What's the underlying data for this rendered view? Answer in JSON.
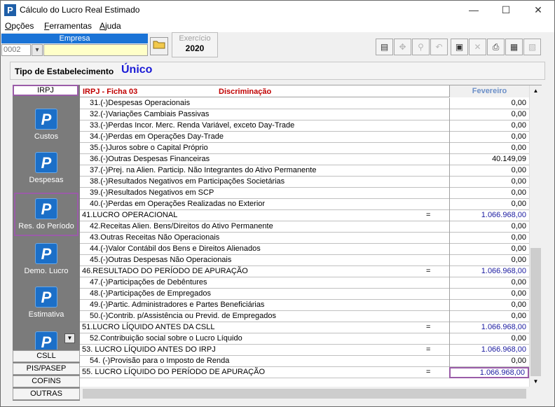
{
  "window": {
    "title": "Cálculo do Lucro Real Estimado",
    "icon_letter": "P",
    "minimize": "—",
    "maximize": "☐",
    "close": "✕"
  },
  "menu": [
    {
      "u": "O",
      "rest": "pções"
    },
    {
      "u": "F",
      "rest": "erramentas"
    },
    {
      "u": "A",
      "rest": "juda"
    }
  ],
  "empresa": {
    "label": "Empresa",
    "code": "0002",
    "name": ""
  },
  "exercicio": {
    "label": "Exercício",
    "value": "2020"
  },
  "estabelecimento": {
    "label": "Tipo de Estabelecimento",
    "value": "Único"
  },
  "nav": {
    "active_tab": "IRPJ",
    "items": [
      {
        "label": "Custos",
        "icon": "P"
      },
      {
        "label": "Despesas",
        "icon": "P"
      },
      {
        "label": "Res. do Período",
        "icon": "P"
      },
      {
        "label": "Demo. Lucro",
        "icon": "P"
      },
      {
        "label": "Estimativa",
        "icon": "P"
      },
      {
        "label": "",
        "icon": "P"
      }
    ],
    "bottom_tabs": [
      "CSLL",
      "PIS/PASEP",
      "COFINS",
      "OUTRAS"
    ]
  },
  "grid": {
    "ficha": "IRPJ - Ficha 03",
    "discriminacao": "Discriminação",
    "month": "Fevereiro",
    "rows": [
      {
        "desc": "31.(-)Despesas Operacionais",
        "value": "0,00",
        "total": false
      },
      {
        "desc": "32.(-)Variações Cambiais Passivas",
        "value": "0,00",
        "total": false
      },
      {
        "desc": "33.(-)Perdas Incor. Merc. Renda Variável, exceto Day-Trade",
        "value": "0,00",
        "total": false
      },
      {
        "desc": "34.(-)Perdas em Operações Day-Trade",
        "value": "0,00",
        "total": false
      },
      {
        "desc": "35.(-)Juros sobre o Capital Próprio",
        "value": "0,00",
        "total": false
      },
      {
        "desc": "36.(-)Outras Despesas Financeiras",
        "value": "40.149,09",
        "total": false
      },
      {
        "desc": "37.(-)Prej. na Alien. Particip. Não Integrantes do Ativo Permanente",
        "value": "0,00",
        "total": false
      },
      {
        "desc": "38.(-)Resultados Negativos em Participações Societárias",
        "value": "0,00",
        "total": false
      },
      {
        "desc": "39.(-)Resultados Negativos em SCP",
        "value": "0,00",
        "total": false
      },
      {
        "desc": "40.(-)Perdas em Operações Realizadas no Exterior",
        "value": "0,00",
        "total": false
      },
      {
        "desc": "41.LUCRO OPERACIONAL",
        "eq": "=",
        "value": "1.066.968,00",
        "total": true
      },
      {
        "desc": "42.Receitas Alien. Bens/Direitos do Ativo Permanente",
        "value": "0,00",
        "total": false
      },
      {
        "desc": "43.Outras Receitas Não Operacionais",
        "value": "0,00",
        "total": false
      },
      {
        "desc": "44.(-)Valor Contábil dos Bens e Direitos Alienados",
        "value": "0,00",
        "total": false
      },
      {
        "desc": "45.(-)Outras Despesas Não Operacionais",
        "value": "0,00",
        "total": false
      },
      {
        "desc": "46.RESULTADO DO PERÍODO DE APURAÇÃO",
        "eq": "=",
        "value": "1.066.968,00",
        "total": true
      },
      {
        "desc": "47.(-)Participações de Debêntures",
        "value": "0,00",
        "total": false
      },
      {
        "desc": "48.(-)Participações de Empregados",
        "value": "0,00",
        "total": false
      },
      {
        "desc": "49.(-)Partic. Administradores e Partes Beneficiárias",
        "value": "0,00",
        "total": false
      },
      {
        "desc": "50.(-)Contrib. p/Assistência ou Previd. de Empregados",
        "value": "0,00",
        "total": false
      },
      {
        "desc": "51.LUCRO LÍQUIDO ANTES DA CSLL",
        "eq": "=",
        "value": "1.066.968,00",
        "total": true
      },
      {
        "desc": "52.Contribuição social sobre o Lucro Líquido",
        "value": "0,00",
        "total": false
      },
      {
        "desc": "53. LUCRO LÍQUIDO ANTES DO IRPJ",
        "eq": "=",
        "value": "1.066.968,00",
        "total": true
      },
      {
        "desc": "54. (-)Provisão para o Imposto de Renda",
        "value": "0,00",
        "total": false
      },
      {
        "desc": "55. LUCRO LÍQUIDO DO PERÍODO DE APURAÇÃO",
        "eq": "=",
        "value": "1.066.968,00",
        "total": true,
        "highlight": true
      }
    ]
  },
  "toolbar_icons": [
    "document-icon",
    "navigate-icon",
    "search-person-icon",
    "undo-icon",
    "save-icon",
    "delete-icon",
    "print-icon",
    "folders-icon",
    "report-icon"
  ],
  "colors": {
    "accent": "#1a73d6",
    "highlight": "#9a5ca8",
    "nav_bg": "#7b7b7b",
    "header_red": "#c00000",
    "estab_blue": "#1a1ad6"
  }
}
